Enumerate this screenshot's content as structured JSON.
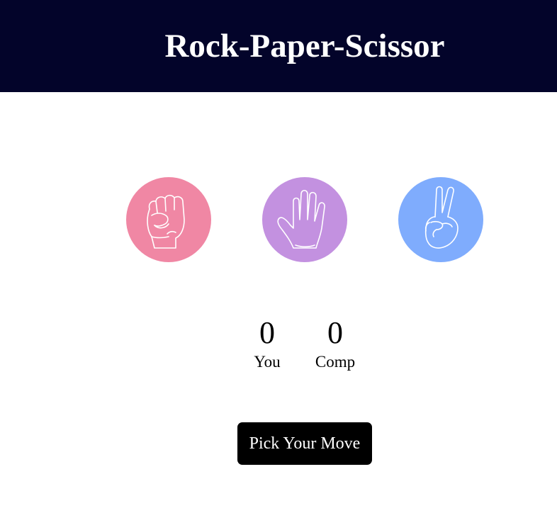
{
  "header": {
    "title": "Rock-Paper-Scissor"
  },
  "choices": [
    {
      "id": "rock",
      "icon": "fist-icon",
      "color": "#f087a4"
    },
    {
      "id": "paper",
      "icon": "open-hand-icon",
      "color": "#c391e0"
    },
    {
      "id": "scissors",
      "icon": "peace-hand-icon",
      "color": "#7facfd"
    }
  ],
  "scoreboard": {
    "user": {
      "score": "0",
      "label": "You"
    },
    "comp": {
      "score": "0",
      "label": "Comp"
    }
  },
  "message": {
    "label": "Pick Your Move",
    "color": "#000000"
  },
  "colors": {
    "header_bg": "#03042a",
    "title": "#ffffff",
    "page_bg": "#ffffff"
  }
}
